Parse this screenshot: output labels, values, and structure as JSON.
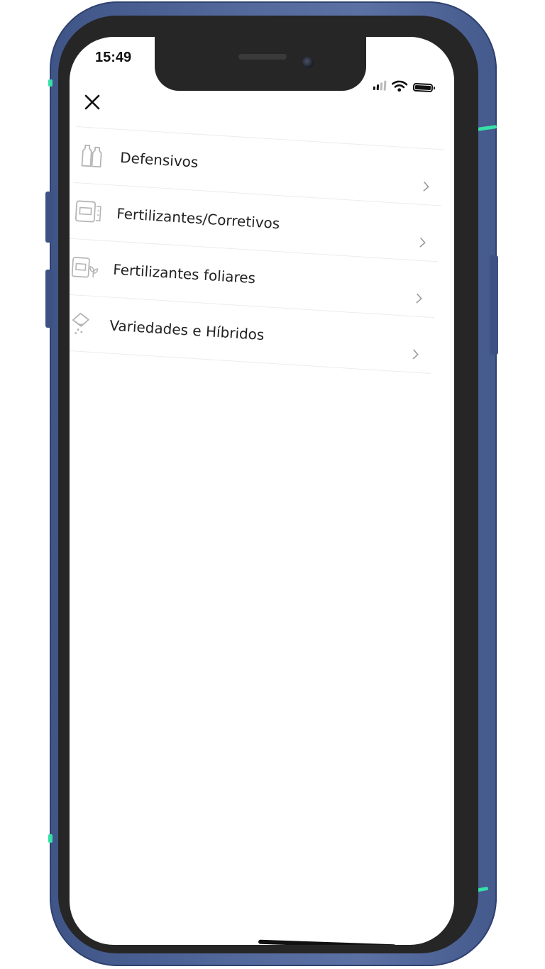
{
  "status_bar": {
    "time": "15:49",
    "signal_icon": "cellular-signal-icon",
    "wifi_icon": "wifi-icon",
    "battery_icon": "battery-icon"
  },
  "header": {
    "close_icon": "close-icon"
  },
  "menu": {
    "items": [
      {
        "label": "Defensivos",
        "icon": "bottles-icon"
      },
      {
        "label": "Fertilizantes/Corretivos",
        "icon": "fertilizer-bag-icon"
      },
      {
        "label": "Fertilizantes foliares",
        "icon": "foliar-fertilizer-icon"
      },
      {
        "label": "Variedades e Híbridos",
        "icon": "seeds-icon"
      }
    ],
    "chevron_icon": "chevron-right-icon"
  },
  "colors": {
    "frame": "#53689a",
    "band_accent": "#36e0a6",
    "bezel": "#262626",
    "screen": "#ffffff",
    "icon_gray": "#b5b5b5",
    "text": "#222222",
    "divider": "#ececec"
  }
}
